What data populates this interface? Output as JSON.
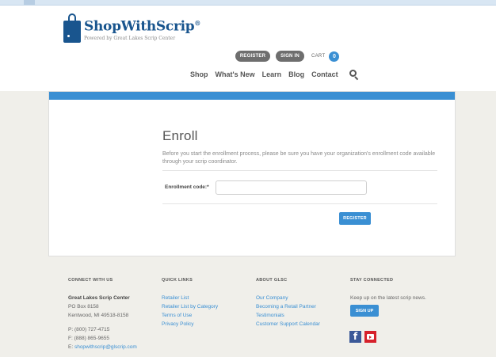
{
  "header": {
    "logo_name": "ShopWithScrip",
    "logo_reg": "®",
    "logo_sub": "Powered by Great Lakes Scrip Center",
    "register_label": "REGISTER",
    "signin_label": "SIGN IN",
    "cart_label": "CART",
    "cart_count": "0",
    "nav": [
      "Shop",
      "What's New",
      "Learn",
      "Blog",
      "Contact"
    ]
  },
  "enroll": {
    "title": "Enroll",
    "description": "Before you start the enrollment process, please be sure you have your organization's enrollment code available through your scrip coordinator.",
    "code_label": "Enrollment code:*",
    "code_value": "",
    "register_button": "REGISTER"
  },
  "footer": {
    "connect": {
      "heading": "CONNECT WITH US",
      "org": "Great Lakes Scrip Center",
      "address1": "PO Box 8158",
      "address2": "Kentwood, MI 49518-8158",
      "phone": "P: (800) 727-4715",
      "fax": "F: (888) 865-9655",
      "email_prefix": "E: ",
      "email": "shopwithscrip@glscrip.com"
    },
    "quick_links": {
      "heading": "QUICK LINKS",
      "items": [
        "Retailer List",
        "Retailer List by Category",
        "Terms of Use",
        "Privacy Policy"
      ]
    },
    "about": {
      "heading": "ABOUT GLSC",
      "items": [
        "Our Company",
        "Becoming a Retail Partner",
        "Testimonials",
        "Customer Support Calendar"
      ]
    },
    "stay": {
      "heading": "STAY CONNECTED",
      "text": "Keep up on the latest scrip news.",
      "signup_label": "SIGN UP"
    }
  },
  "colors": {
    "brand_blue": "#19558e",
    "accent_blue": "#3a8fd3",
    "facebook": "#3b5998",
    "youtube": "#d6212b"
  },
  "icons": [
    "shopping-bag-logo-icon",
    "search-icon",
    "facebook-icon",
    "youtube-icon"
  ]
}
